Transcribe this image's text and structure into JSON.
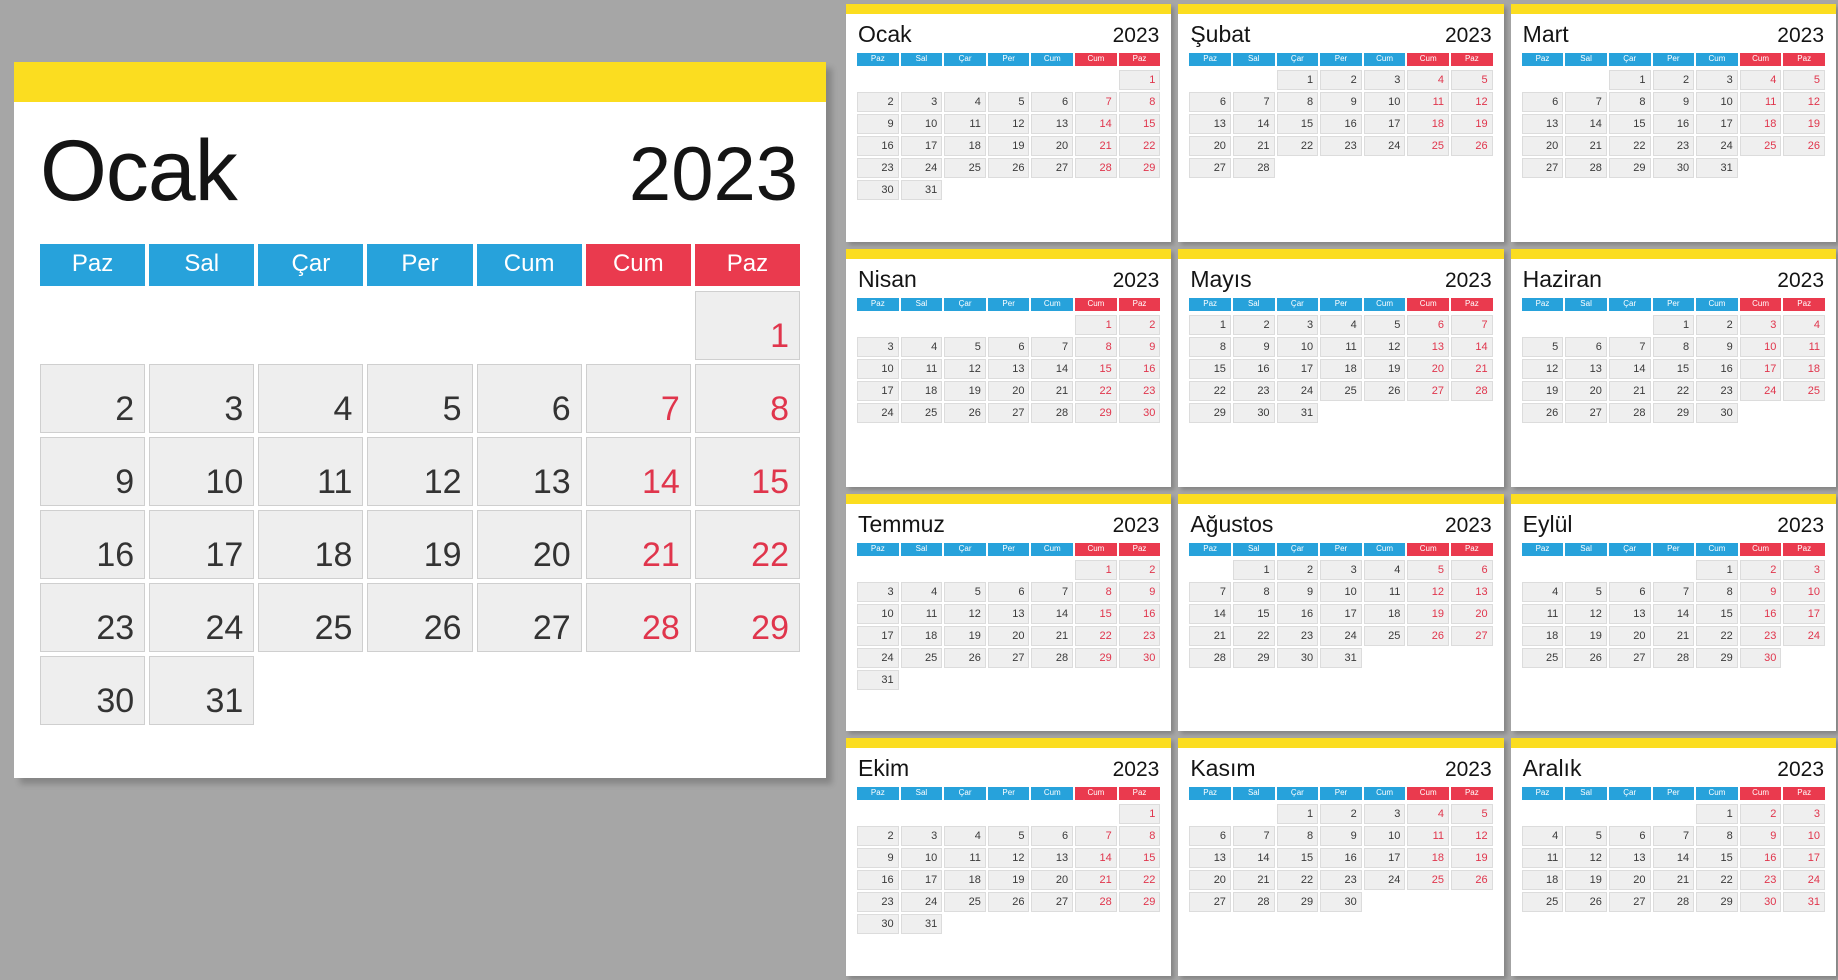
{
  "colors": {
    "page_background": "#a6a6a6",
    "accent_yellow": "#fbdd20",
    "weekday_blue": "#27a2db",
    "weekend_red": "#ea3a4e",
    "weekend_text_red": "#e0354c",
    "cell_gray": "#eeeeee",
    "card_white": "#ffffff"
  },
  "year": "2023",
  "weekday_headers": [
    "Paz",
    "Sal",
    "Çar",
    "Per",
    "Cum",
    "Cum",
    "Paz"
  ],
  "weekend_columns": [
    5,
    6
  ],
  "featured": {
    "month": "Ocak",
    "year": "2023",
    "weekday_headers": [
      "Paz",
      "Sal",
      "Çar",
      "Per",
      "Cum",
      "Cum",
      "Paz"
    ],
    "leading_blanks": 6,
    "days": [
      1,
      2,
      3,
      4,
      5,
      6,
      7,
      8,
      9,
      10,
      11,
      12,
      13,
      14,
      15,
      16,
      17,
      18,
      19,
      20,
      21,
      22,
      23,
      24,
      25,
      26,
      27,
      28,
      29,
      30,
      31
    ]
  },
  "months": [
    {
      "name": "Ocak",
      "year": "2023",
      "leading_blanks": 6,
      "days_in_month": 31
    },
    {
      "name": "Şubat",
      "year": "2023",
      "leading_blanks": 2,
      "days_in_month": 28
    },
    {
      "name": "Mart",
      "year": "2023",
      "leading_blanks": 2,
      "days_in_month": 31
    },
    {
      "name": "Nisan",
      "year": "2023",
      "leading_blanks": 5,
      "days_in_month": 30
    },
    {
      "name": "Mayıs",
      "year": "2023",
      "leading_blanks": 0,
      "days_in_month": 31
    },
    {
      "name": "Haziran",
      "year": "2023",
      "leading_blanks": 3,
      "days_in_month": 30
    },
    {
      "name": "Temmuz",
      "year": "2023",
      "leading_blanks": 5,
      "days_in_month": 31
    },
    {
      "name": "Ağustos",
      "year": "2023",
      "leading_blanks": 1,
      "days_in_month": 31
    },
    {
      "name": "Eylül",
      "year": "2023",
      "leading_blanks": 4,
      "days_in_month": 30
    },
    {
      "name": "Ekim",
      "year": "2023",
      "leading_blanks": 6,
      "days_in_month": 31
    },
    {
      "name": "Kasım",
      "year": "2023",
      "leading_blanks": 2,
      "days_in_month": 30
    },
    {
      "name": "Aralık",
      "year": "2023",
      "leading_blanks": 4,
      "days_in_month": 31
    }
  ]
}
